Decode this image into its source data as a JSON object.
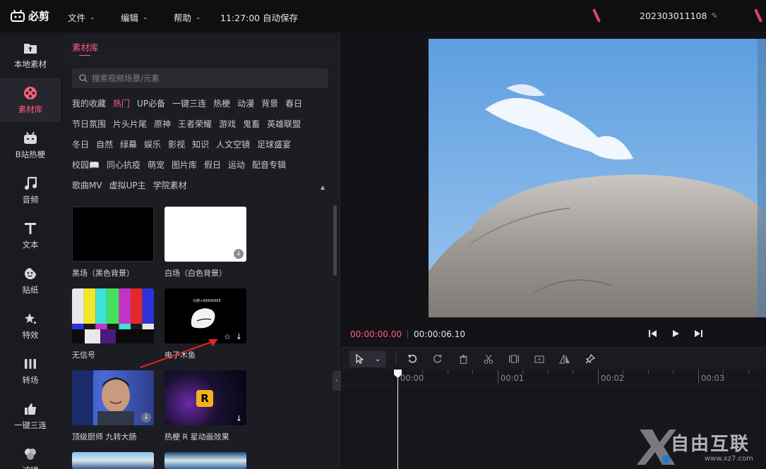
{
  "app": {
    "logo_text": "必剪",
    "menus": [
      {
        "label": "文件"
      },
      {
        "label": "编辑"
      },
      {
        "label": "帮助"
      }
    ],
    "autosave": "11:27:00 自动保存",
    "project_name": "202303011108",
    "accent_color": "#ff5e7e"
  },
  "leftnav": {
    "items": [
      {
        "label": "本地素材",
        "icon": "upload-folder-icon"
      },
      {
        "label": "素材库",
        "icon": "film-reel-icon",
        "active": true
      },
      {
        "label": "B站热梗",
        "icon": "bilibili-tv-icon"
      },
      {
        "label": "音频",
        "icon": "music-note-icon"
      },
      {
        "label": "文本",
        "icon": "text-t-icon"
      },
      {
        "label": "贴纸",
        "icon": "sticker-face-icon"
      },
      {
        "label": "特效",
        "icon": "sparkle-star-icon"
      },
      {
        "label": "转场",
        "icon": "transition-icon"
      },
      {
        "label": "一键三连",
        "icon": "thumbs-up-icon"
      },
      {
        "label": "滤镜",
        "icon": "filter-circles-icon"
      }
    ]
  },
  "library": {
    "tab_label": "素材库",
    "search_placeholder": "搜索视频场景/元素",
    "tag_rows": [
      [
        "我的收藏",
        "热门",
        "UP必备",
        "一键三连",
        "热梗",
        "动漫",
        "背景",
        "春日"
      ],
      [
        "节日氛围",
        "片头片尾",
        "原神",
        "王者荣耀",
        "游戏",
        "鬼畜",
        "英雄联盟"
      ],
      [
        "冬日",
        "自然",
        "绿幕",
        "娱乐",
        "影视",
        "知识",
        "人文空镜",
        "足球盛宴"
      ],
      [
        "校园📖",
        "同心抗疫",
        "萌宠",
        "图片库",
        "假日",
        "运动",
        "配音专辑"
      ],
      [
        "歌曲MV",
        "虚拟UP主",
        "学院素材"
      ]
    ],
    "active_tag": "热门",
    "cards": [
      {
        "label": "黑场（黑色背景）",
        "download": false
      },
      {
        "label": "白场（白色背景）",
        "download": true
      },
      {
        "label": "无信号",
        "download": false
      },
      {
        "label": "电子木鱼",
        "download": true,
        "favorite": true,
        "thumb_text": "功德+88888888"
      },
      {
        "label": "顶级厨师 九转大肠",
        "download": true
      },
      {
        "label": "热梗 R 星动画效果",
        "download": true,
        "thumb_text": "R"
      }
    ]
  },
  "preview": {
    "current_time": "00:00:00.00",
    "total_time": "00:00:06.10"
  },
  "timeline": {
    "ruler_labels": [
      "00:00",
      "00:01",
      "00:02",
      "00:03"
    ]
  },
  "watermark": {
    "text": "自由互联",
    "url": "www.xz7.com"
  }
}
